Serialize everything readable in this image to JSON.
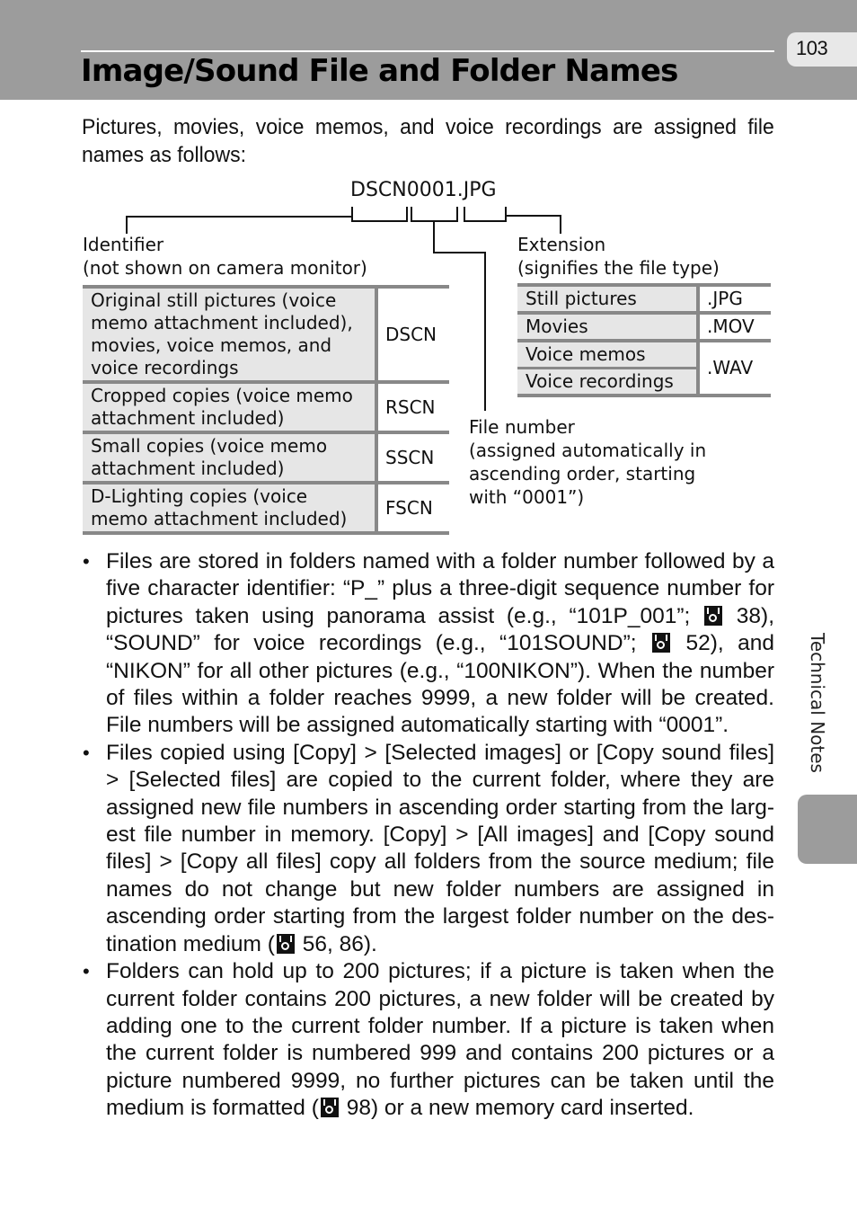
{
  "header": {
    "title": "Image/Sound File and Folder Names",
    "page_number": "103"
  },
  "intro": "Pictures, movies, voice memos, and voice recordings are assigned file names as follows:",
  "diagram": {
    "filename_example": "DSCN0001.JPG",
    "identifier_label": "Identifier",
    "identifier_note": "(not shown on camera monitor)",
    "extension_label": "Extension",
    "extension_note": "(signifies the file type)",
    "file_number_label": "File number",
    "file_number_note_lines": [
      "(assigned automatically in",
      "ascending order, starting",
      "with “0001”)"
    ],
    "identifier_table": [
      {
        "description": "Original still pictures (voice memo attachment included), movies, voice memos, and voice recordings",
        "code": "DSCN"
      },
      {
        "description": "Cropped copies (voice memo attachment included)",
        "code": "RSCN"
      },
      {
        "description": "Small copies (voice memo attachment included)",
        "code": "SSCN"
      },
      {
        "description": "D-Lighting copies (voice memo attachment included)",
        "code": "FSCN"
      }
    ],
    "extension_table": [
      {
        "description": "Still pictures",
        "code": ".JPG"
      },
      {
        "description": "Movies",
        "code": ".MOV"
      },
      {
        "description": "Voice memos",
        "code": ".WAV"
      },
      {
        "description": "Voice recordings",
        "code": ""
      }
    ]
  },
  "bullets": [
    {
      "parts": [
        "Files are stored in folders named with a folder number followed by a five character identifier: “P_” plus a three-digit sequence number for pictures taken using panorama assist (e.g., “101P_001”; ",
        " 38), “SOUND” for voice recordings (e.g., “101SOUND”; ",
        " 52), and “NIKON” for all other pictures (e.g., “100NIKON”). When the num­ber of files within a folder reaches 9999, a new folder will be cre­ated. File numbers will be assigned automatically starting with “0001”."
      ]
    },
    {
      "parts": [
        "Files copied using [Copy] > [Selected images] or [Copy sound files] > [Selected files] are copied to the current folder, where they are assigned new file numbers in ascending order starting from the larg­est file number in memory. [Copy] > [All images] and [Copy sound files] > [Copy all files] copy all folders from the source medium; file names do not change but new folder numbers are assigned in ascending order starting from the largest folder number on the des­tination medium (",
        " 56, 86)."
      ]
    },
    {
      "parts": [
        "Folders can hold up to 200 pictures; if a picture is taken when the current folder contains 200 pictures, a new folder will be created by adding one to the current folder number. If a picture is taken when the current folder is numbered 999 and contains 200 pictures or a picture numbered 9999, no further pictures can be taken until the medium is formatted (",
        " 98) or a new memory card inserted."
      ]
    }
  ],
  "bullet_glyph": "•",
  "reference_icon": "page-reference-icon",
  "side_tab_label": "Technical Notes",
  "colors": {
    "header_band": "#9c9c9c",
    "table_rule": "#888888",
    "table_cell_bg": "#e6e6e6",
    "page_tab": "#e8e8e8"
  }
}
